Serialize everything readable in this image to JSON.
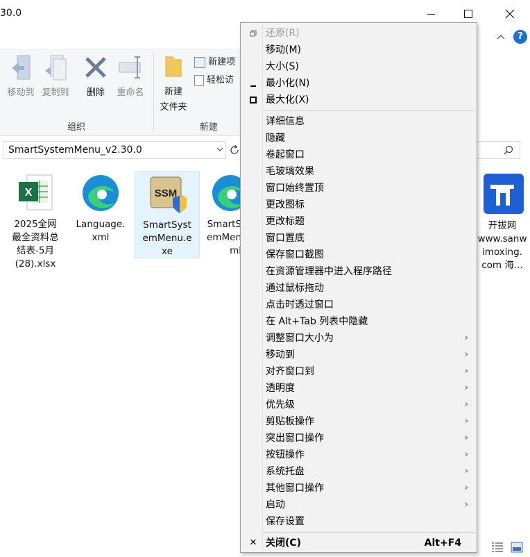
{
  "window": {
    "title": "30.0",
    "minimize_icon": "minimize-icon",
    "maximize_icon": "maximize-icon",
    "close_icon": "close-icon",
    "help_icon": "help-icon"
  },
  "ribbon": {
    "groups": [
      {
        "label": "组织",
        "buttons": [
          "移动到",
          "复制到",
          "删除",
          "重命名"
        ]
      },
      {
        "label": "新建",
        "buttons": [
          "新建文件夹",
          "新建项",
          "轻松访"
        ]
      }
    ],
    "btn_moveto": "移动到",
    "btn_copyto": "复制到",
    "btn_delete": "删除",
    "btn_rename": "重命名",
    "btn_newfolder_1": "新建",
    "btn_newfolder_2": "文件夹",
    "btn_newitem": "新建项",
    "btn_easyaccess": "轻松访",
    "group_organize": "组织",
    "group_new": "新建"
  },
  "address": {
    "path": "SmartSystemMenu_v2.30.0",
    "dropdown_icon": "chevron-down-icon",
    "refresh_icon": "refresh-icon",
    "search_icon": "search-icon"
  },
  "files": [
    {
      "name_lines": [
        "2025全网",
        "最全资料总",
        "结表-5月",
        "(28).xlsx"
      ],
      "icon": "excel-file-icon"
    },
    {
      "name_lines": [
        "Language.",
        "xml"
      ],
      "icon": "edge-xml-icon"
    },
    {
      "name_lines": [
        "SmartSyst",
        "emMenu.e",
        "xe"
      ],
      "icon": "ssm-app-icon",
      "selected": true
    },
    {
      "name_lines": [
        "SmartS",
        "emMen",
        "ml"
      ],
      "icon": "edge-xml-icon"
    },
    {
      "name_lines": [
        "开拔网",
        "www.sanw",
        "imoxing.",
        "com 海..."
      ],
      "icon": "website-shortcut-icon"
    }
  ],
  "menu": {
    "restore": "还原(R)",
    "move": "移动(M)",
    "size": "大小(S)",
    "minimize": "最小化(N)",
    "maximize": "最大化(X)",
    "items": [
      "详细信息",
      "隐藏",
      "卷起窗口",
      "毛玻璃效果",
      "窗口始终置顶",
      "更改图标",
      "更改标题",
      "窗口置底",
      "保存窗口截图",
      "在资源管理器中进入程序路径",
      "通过鼠标拖动",
      "点击时透过窗口",
      "在 Alt+Tab 列表中隐藏"
    ],
    "submenus": [
      "调整窗口大小为",
      "移动到",
      "对齐窗口到",
      "透明度",
      "优先级",
      "剪贴板操作",
      "突出窗口操作",
      "按钮操作",
      "系统托盘",
      "其他窗口操作",
      "启动"
    ],
    "save_settings": "保存设置",
    "close": "关闭(C)",
    "close_shortcut": "Alt+F4",
    "submenu_arrow": "›"
  },
  "statusbar": {
    "details_view_icon": "details-view-icon",
    "large_icons_view_icon": "large-icons-view-icon"
  }
}
